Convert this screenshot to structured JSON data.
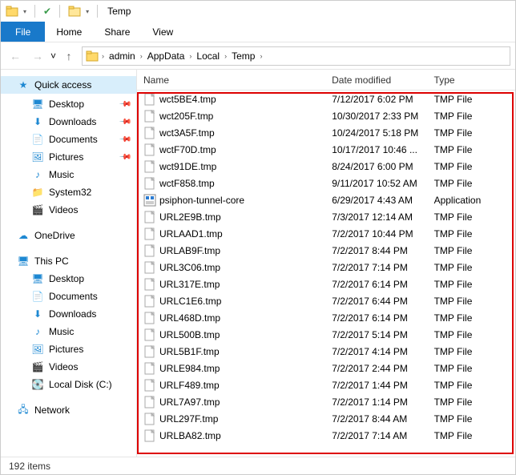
{
  "window": {
    "title": "Temp"
  },
  "qat": {
    "check": "✔"
  },
  "ribbon": {
    "file": "File",
    "home": "Home",
    "share": "Share",
    "view": "View"
  },
  "path": [
    "admin",
    "AppData",
    "Local",
    "Temp"
  ],
  "nav": {
    "quick": "Quick access",
    "items": [
      {
        "label": "Desktop",
        "pinned": true
      },
      {
        "label": "Downloads",
        "pinned": true
      },
      {
        "label": "Documents",
        "pinned": true
      },
      {
        "label": "Pictures",
        "pinned": true
      },
      {
        "label": "Music",
        "pinned": false
      },
      {
        "label": "System32",
        "pinned": false
      },
      {
        "label": "Videos",
        "pinned": false
      }
    ],
    "onedrive": "OneDrive",
    "thispc": "This PC",
    "pc_items": [
      {
        "label": "Desktop"
      },
      {
        "label": "Documents"
      },
      {
        "label": "Downloads"
      },
      {
        "label": "Music"
      },
      {
        "label": "Pictures"
      },
      {
        "label": "Videos"
      },
      {
        "label": "Local Disk (C:)"
      }
    ],
    "network": "Network"
  },
  "columns": {
    "name": "Name",
    "date": "Date modified",
    "type": "Type"
  },
  "files": [
    {
      "name": "wct5BE4.tmp",
      "date": "7/12/2017 6:02 PM",
      "type": "TMP File",
      "kind": "tmp"
    },
    {
      "name": "wct205F.tmp",
      "date": "10/30/2017 2:33 PM",
      "type": "TMP File",
      "kind": "tmp"
    },
    {
      "name": "wct3A5F.tmp",
      "date": "10/24/2017 5:18 PM",
      "type": "TMP File",
      "kind": "tmp"
    },
    {
      "name": "wctF70D.tmp",
      "date": "10/17/2017 10:46 ...",
      "type": "TMP File",
      "kind": "tmp"
    },
    {
      "name": "wct91DE.tmp",
      "date": "8/24/2017 6:00 PM",
      "type": "TMP File",
      "kind": "tmp"
    },
    {
      "name": "wctF858.tmp",
      "date": "9/11/2017 10:52 AM",
      "type": "TMP File",
      "kind": "tmp"
    },
    {
      "name": "psiphon-tunnel-core",
      "date": "6/29/2017 4:43 AM",
      "type": "Application",
      "kind": "exe"
    },
    {
      "name": "URL2E9B.tmp",
      "date": "7/3/2017 12:14 AM",
      "type": "TMP File",
      "kind": "tmp"
    },
    {
      "name": "URLAAD1.tmp",
      "date": "7/2/2017 10:44 PM",
      "type": "TMP File",
      "kind": "tmp"
    },
    {
      "name": "URLAB9F.tmp",
      "date": "7/2/2017 8:44 PM",
      "type": "TMP File",
      "kind": "tmp"
    },
    {
      "name": "URL3C06.tmp",
      "date": "7/2/2017 7:14 PM",
      "type": "TMP File",
      "kind": "tmp"
    },
    {
      "name": "URL317E.tmp",
      "date": "7/2/2017 6:14 PM",
      "type": "TMP File",
      "kind": "tmp"
    },
    {
      "name": "URLC1E6.tmp",
      "date": "7/2/2017 6:44 PM",
      "type": "TMP File",
      "kind": "tmp"
    },
    {
      "name": "URL468D.tmp",
      "date": "7/2/2017 6:14 PM",
      "type": "TMP File",
      "kind": "tmp"
    },
    {
      "name": "URL500B.tmp",
      "date": "7/2/2017 5:14 PM",
      "type": "TMP File",
      "kind": "tmp"
    },
    {
      "name": "URL5B1F.tmp",
      "date": "7/2/2017 4:14 PM",
      "type": "TMP File",
      "kind": "tmp"
    },
    {
      "name": "URLE984.tmp",
      "date": "7/2/2017 2:44 PM",
      "type": "TMP File",
      "kind": "tmp"
    },
    {
      "name": "URLF489.tmp",
      "date": "7/2/2017 1:44 PM",
      "type": "TMP File",
      "kind": "tmp"
    },
    {
      "name": "URL7A97.tmp",
      "date": "7/2/2017 1:14 PM",
      "type": "TMP File",
      "kind": "tmp"
    },
    {
      "name": "URL297F.tmp",
      "date": "7/2/2017 8:44 AM",
      "type": "TMP File",
      "kind": "tmp"
    },
    {
      "name": "URLBA82.tmp",
      "date": "7/2/2017 7:14 AM",
      "type": "TMP File",
      "kind": "tmp"
    }
  ],
  "status": {
    "count": "192 items"
  }
}
